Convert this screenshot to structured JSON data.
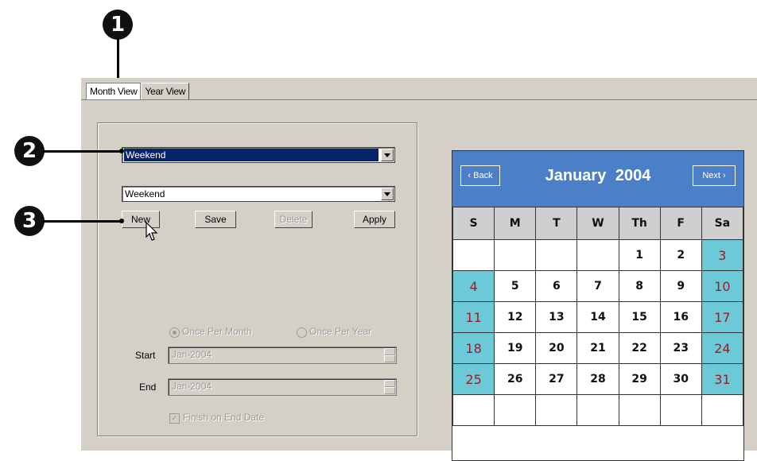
{
  "callouts": [
    "1",
    "2",
    "3"
  ],
  "tabs": [
    {
      "label": "Month View",
      "active": true
    },
    {
      "label": "Year View",
      "active": false
    }
  ],
  "schedule": {
    "selector_value": "Weekend",
    "name_value": "Weekend",
    "buttons": {
      "new": "New",
      "save": "Save",
      "delete": "Delete",
      "apply": "Apply"
    },
    "recurrence": {
      "once_per_month": "Once Per Month",
      "once_per_year": "Once Per Year"
    },
    "start_label": "Start",
    "start_value": "Jan-2004",
    "end_label": "End",
    "end_value": "Jan-2004",
    "finish_on_end_date": "Finish on End Date"
  },
  "calendar": {
    "back_label": "‹ Back",
    "next_label": "Next ›",
    "title": "January  2004",
    "days_of_week": [
      "S",
      "M",
      "T",
      "W",
      "Th",
      "F",
      "Sa"
    ],
    "weeks": [
      [
        "",
        "",
        "",
        "",
        "1",
        "2",
        "3"
      ],
      [
        "4",
        "5",
        "6",
        "7",
        "8",
        "9",
        "10"
      ],
      [
        "11",
        "12",
        "13",
        "14",
        "15",
        "16",
        "17"
      ],
      [
        "18",
        "19",
        "20",
        "21",
        "22",
        "23",
        "24"
      ],
      [
        "25",
        "26",
        "27",
        "28",
        "29",
        "30",
        "31"
      ],
      [
        "",
        "",
        "",
        "",
        "",
        "",
        ""
      ]
    ],
    "header_color": "#4b7fc8",
    "weekend_color": "#6ccad8"
  }
}
